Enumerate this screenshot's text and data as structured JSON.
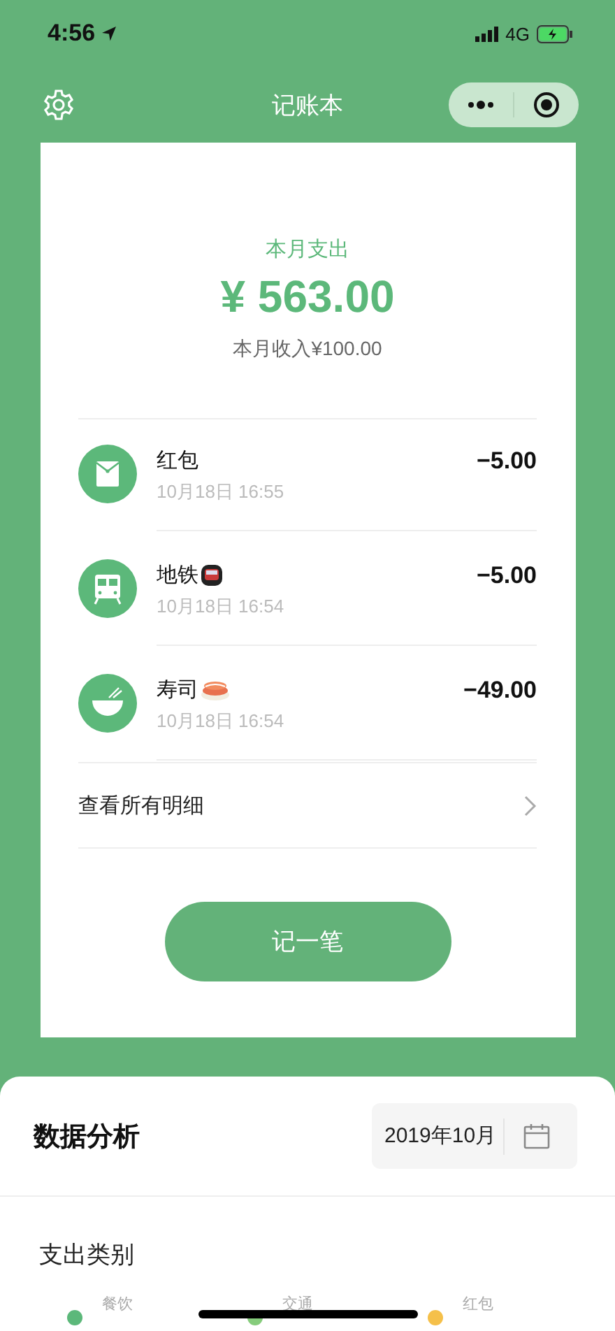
{
  "status_bar": {
    "time": "4:56",
    "network": "4G"
  },
  "nav": {
    "title": "记账本"
  },
  "summary": {
    "label": "本月支出",
    "amount": "¥ 563.00",
    "income": "本月收入¥100.00"
  },
  "records": [
    {
      "kind": "red_packet",
      "title": "红包",
      "time": "10月18日 16:55",
      "amount": "−5.00"
    },
    {
      "kind": "transport",
      "title": "地铁",
      "time": "10月18日 16:54",
      "amount": "−5.00"
    },
    {
      "kind": "food",
      "title": "寿司",
      "time": "10月18日 16:54",
      "amount": "−49.00"
    }
  ],
  "all_link": "查看所有明细",
  "add_button": "记一笔",
  "analysis": {
    "title": "数据分析",
    "month": "2019年10月",
    "section": "支出类别",
    "legend": [
      {
        "label": "餐饮",
        "color": "#5cb87a"
      },
      {
        "label": "交通",
        "color": "#86cc7c"
      },
      {
        "label": "红包",
        "color": "#f5c04a"
      }
    ]
  }
}
